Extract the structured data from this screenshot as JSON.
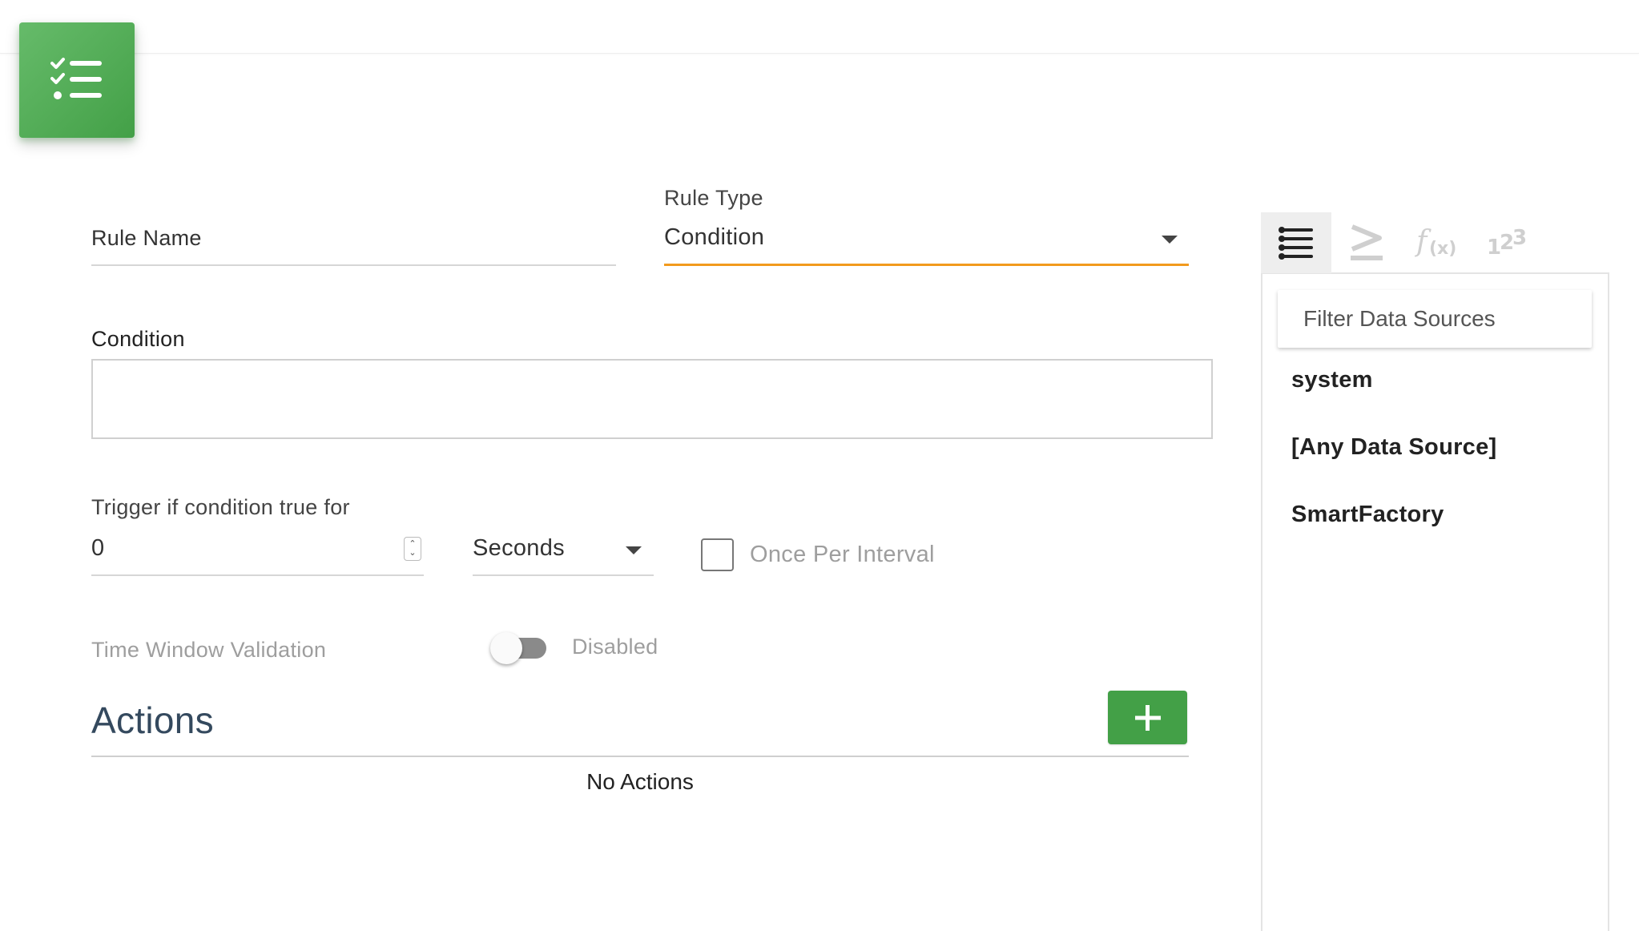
{
  "header": {
    "icon": "checklist-icon",
    "accent": "#4caf50"
  },
  "form": {
    "rule_name": {
      "placeholder": "Rule Name",
      "value": ""
    },
    "rule_type": {
      "label": "Rule Type",
      "value": "Condition",
      "accent": "#f29a1d"
    },
    "condition": {
      "label": "Condition",
      "value": ""
    },
    "trigger": {
      "label": "Trigger if condition true for",
      "value": "0",
      "unit": "Seconds",
      "once_per_interval_label": "Once Per Interval",
      "once_per_interval_checked": false
    },
    "time_window": {
      "label": "Time Window Validation",
      "status": "Disabled",
      "enabled": false
    }
  },
  "actions": {
    "title": "Actions",
    "add_icon": "plus-icon",
    "empty_text": "No Actions"
  },
  "side_panel": {
    "tabs": [
      {
        "icon": "list-icon",
        "active": true
      },
      {
        "icon": "greater-equal-icon",
        "active": false
      },
      {
        "icon": "function-icon",
        "active": false
      },
      {
        "icon": "numbers-icon",
        "active": false
      }
    ],
    "filter_placeholder": "Filter Data Sources",
    "data_sources": [
      "system",
      "[Any Data Source]",
      "SmartFactory"
    ]
  }
}
